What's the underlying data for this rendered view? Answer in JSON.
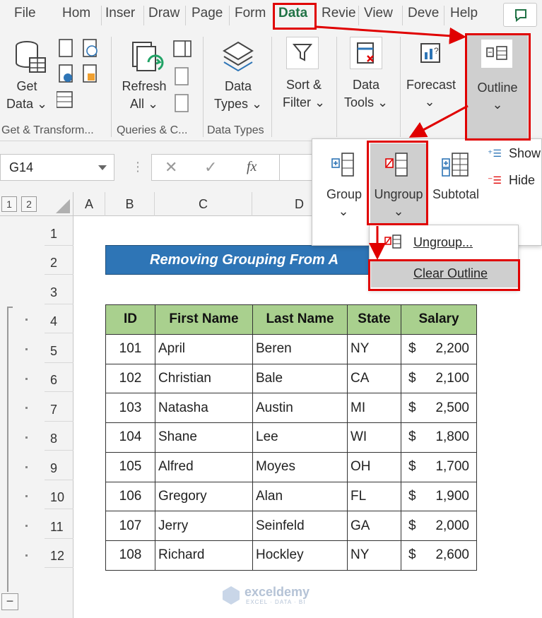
{
  "tabs": [
    "File",
    "Hom",
    "Inser",
    "Draw",
    "Page",
    "Form",
    "Data",
    "Revie",
    "View",
    "Deve",
    "Help"
  ],
  "ribbon": {
    "get_data": [
      "Get",
      "Data ⌄"
    ],
    "refresh_all": [
      "Refresh",
      "All ⌄"
    ],
    "data_types": [
      "Data",
      "Types ⌄"
    ],
    "sort_filter": [
      "Sort &",
      "Filter ⌄"
    ],
    "data_tools": [
      "Data",
      "Tools ⌄"
    ],
    "forecast": "Forecast",
    "outline": "Outline",
    "groups": [
      "Get & Transform...",
      "Queries & C...",
      "Data Types"
    ]
  },
  "formula_bar": {
    "name_box": "G14",
    "fx": "fx"
  },
  "columns": [
    "A",
    "B",
    "C",
    "D"
  ],
  "outline_levels": [
    "1",
    "2"
  ],
  "rows": [
    "1",
    "2",
    "3",
    "4",
    "5",
    "6",
    "7",
    "8",
    "9",
    "10",
    "11",
    "12"
  ],
  "outline_popup": {
    "group": "Group",
    "ungroup": "Ungroup",
    "subtotal": "Subtotal",
    "show": "Show",
    "hide": "Hide"
  },
  "ungroup_menu": {
    "ungroup_item": "Ungroup...",
    "clear_outline": "Clear Outline"
  },
  "title_text": "Removing Grouping From A",
  "table": {
    "headers": [
      "ID",
      "First Name",
      "Last Name",
      "State",
      "Salary"
    ],
    "rows": [
      [
        "101",
        "April",
        "Beren",
        "NY",
        "$",
        "2,200"
      ],
      [
        "102",
        "Christian",
        "Bale",
        "CA",
        "$",
        "2,100"
      ],
      [
        "103",
        "Natasha",
        "Austin",
        "MI",
        "$",
        "2,500"
      ],
      [
        "104",
        "Shane",
        "Lee",
        "WI",
        "$",
        "1,800"
      ],
      [
        "105",
        "Alfred",
        "Moyes",
        "OH",
        "$",
        "1,700"
      ],
      [
        "106",
        "Gregory",
        "Alan",
        "FL",
        "$",
        "1,900"
      ],
      [
        "107",
        "Jerry",
        "Seinfeld",
        "GA",
        "$",
        "2,000"
      ],
      [
        "108",
        "Richard",
        "Hockley",
        "NY",
        "$",
        "2,600"
      ]
    ]
  },
  "watermark": {
    "brand": "exceldemy",
    "tagline": "EXCEL · DATA · BI"
  },
  "colors": {
    "highlight": "#e00000",
    "title_bg": "#2e75b6",
    "header_bg": "#a9d08e",
    "green": "#217346"
  },
  "collapse_symbol": "−"
}
